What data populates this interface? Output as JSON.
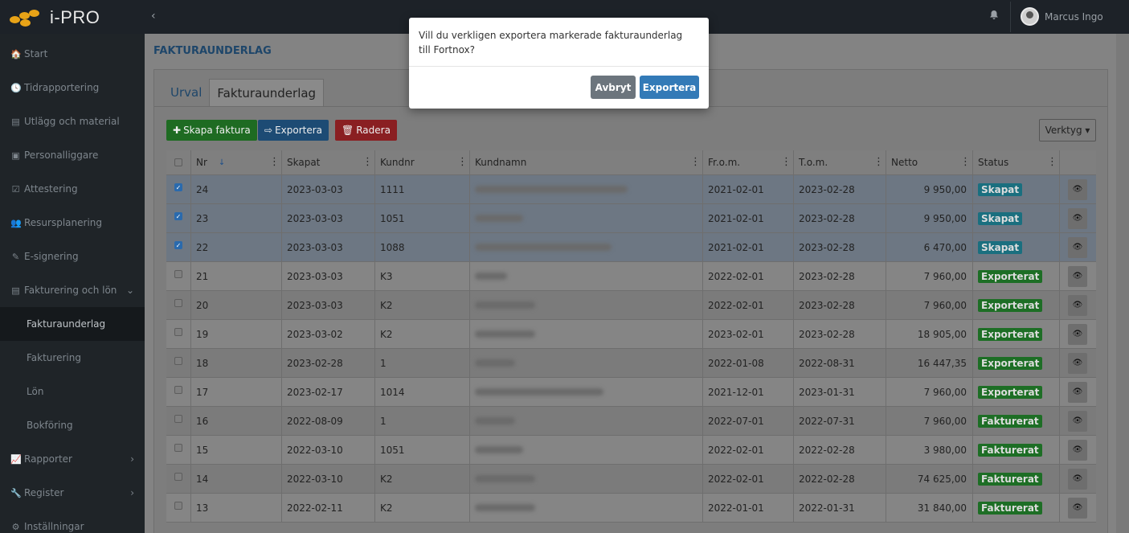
{
  "app": {
    "logo_text": "i-PRO",
    "logo_dot_color": "#e8a317"
  },
  "header": {
    "collapse_icon": "‹",
    "bell_icon": "bell-icon",
    "user_name": "Marcus Ingo"
  },
  "sidebar": {
    "items": [
      {
        "icon": "🏠",
        "label": "Start"
      },
      {
        "icon": "🕓",
        "label": "Tidrapportering"
      },
      {
        "icon": "▤",
        "label": "Utlägg och material"
      },
      {
        "icon": "▣",
        "label": "Personalliggare"
      },
      {
        "icon": "☑",
        "label": "Attestering"
      },
      {
        "icon": "👥",
        "label": "Resursplanering"
      },
      {
        "icon": "✎",
        "label": "E-signering"
      },
      {
        "icon": "▤",
        "label": "Fakturering och lön",
        "chevron": "⌄"
      },
      {
        "label": "Fakturaunderlag",
        "sub": true,
        "active": true
      },
      {
        "label": "Fakturering",
        "sub": true
      },
      {
        "label": "Lön",
        "sub": true
      },
      {
        "label": "Bokföring",
        "sub": true
      },
      {
        "icon": "📈",
        "label": "Rapporter",
        "chevron": "›"
      },
      {
        "icon": "🔧",
        "label": "Register",
        "chevron": "›"
      },
      {
        "icon": "⚙",
        "label": "Inställningar"
      }
    ]
  },
  "page": {
    "title": "FAKTURAUNDERLAG",
    "tabs": [
      {
        "label": "Urval"
      },
      {
        "label": "Fakturaunderlag",
        "active": true
      }
    ],
    "toolbar": {
      "create_label": "Skapa faktura",
      "export_label": "Exportera",
      "delete_label": "Radera",
      "tools_label": "Verktyg ▾"
    }
  },
  "table": {
    "columns": [
      "Nr",
      "Skapat",
      "Kundnr",
      "Kundnamn",
      "Fr.o.m.",
      "T.o.m.",
      "Netto",
      "Status"
    ],
    "sort_indicator": "↓",
    "rows": [
      {
        "checked": true,
        "nr": "24",
        "skapat": "2023-03-03",
        "kundnr": "1111",
        "blur_w": 190,
        "from": "2021-02-01",
        "to": "2023-02-28",
        "netto": "9 950,00",
        "status": "Skapat"
      },
      {
        "checked": true,
        "nr": "23",
        "skapat": "2023-03-03",
        "kundnr": "1051",
        "blur_w": 60,
        "from": "2021-02-01",
        "to": "2023-02-28",
        "netto": "9 950,00",
        "status": "Skapat"
      },
      {
        "checked": true,
        "nr": "22",
        "skapat": "2023-03-03",
        "kundnr": "1088",
        "blur_w": 170,
        "from": "2021-02-01",
        "to": "2023-02-28",
        "netto": "6 470,00",
        "status": "Skapat"
      },
      {
        "checked": false,
        "nr": "21",
        "skapat": "2023-03-03",
        "kundnr": "K3",
        "blur_w": 40,
        "from": "2022-02-01",
        "to": "2023-02-28",
        "netto": "7 960,00",
        "status": "Exporterat"
      },
      {
        "checked": false,
        "nr": "20",
        "skapat": "2023-03-03",
        "kundnr": "K2",
        "blur_w": 75,
        "from": "2022-02-01",
        "to": "2023-02-28",
        "netto": "7 960,00",
        "status": "Exporterat"
      },
      {
        "checked": false,
        "nr": "19",
        "skapat": "2023-03-02",
        "kundnr": "K2",
        "blur_w": 75,
        "from": "2023-02-01",
        "to": "2023-02-28",
        "netto": "18 905,00",
        "status": "Exporterat"
      },
      {
        "checked": false,
        "nr": "18",
        "skapat": "2023-02-28",
        "kundnr": "1",
        "blur_w": 50,
        "from": "2022-01-08",
        "to": "2022-08-31",
        "netto": "16 447,35",
        "status": "Exporterat"
      },
      {
        "checked": false,
        "nr": "17",
        "skapat": "2023-02-17",
        "kundnr": "1014",
        "blur_w": 160,
        "from": "2021-12-01",
        "to": "2023-01-31",
        "netto": "7 960,00",
        "status": "Exporterat"
      },
      {
        "checked": false,
        "nr": "16",
        "skapat": "2022-08-09",
        "kundnr": "1",
        "blur_w": 50,
        "from": "2022-07-01",
        "to": "2022-07-31",
        "netto": "7 960,00",
        "status": "Fakturerat"
      },
      {
        "checked": false,
        "nr": "15",
        "skapat": "2022-03-10",
        "kundnr": "1051",
        "blur_w": 60,
        "from": "2022-02-01",
        "to": "2022-02-28",
        "netto": "3 980,00",
        "status": "Fakturerat"
      },
      {
        "checked": false,
        "nr": "14",
        "skapat": "2022-03-10",
        "kundnr": "K2",
        "blur_w": 75,
        "from": "2022-02-01",
        "to": "2022-02-28",
        "netto": "74 625,00",
        "status": "Fakturerat"
      },
      {
        "checked": false,
        "nr": "13",
        "skapat": "2022-02-11",
        "kundnr": "K2",
        "blur_w": 75,
        "from": "2022-01-01",
        "to": "2022-01-31",
        "netto": "31 840,00",
        "status": "Fakturerat"
      }
    ]
  },
  "status_colors": {
    "Skapat": "#1a6f7f",
    "Exporterat": "#1d6e25",
    "Fakturerat": "#1d6e25"
  },
  "modal": {
    "message": "Vill du verkligen exportera markerade fakturaunderlag till Fortnox?",
    "cancel_label": "Avbryt",
    "confirm_label": "Exportera",
    "cancel_color": "#6c757d",
    "confirm_color": "#337ab7"
  }
}
